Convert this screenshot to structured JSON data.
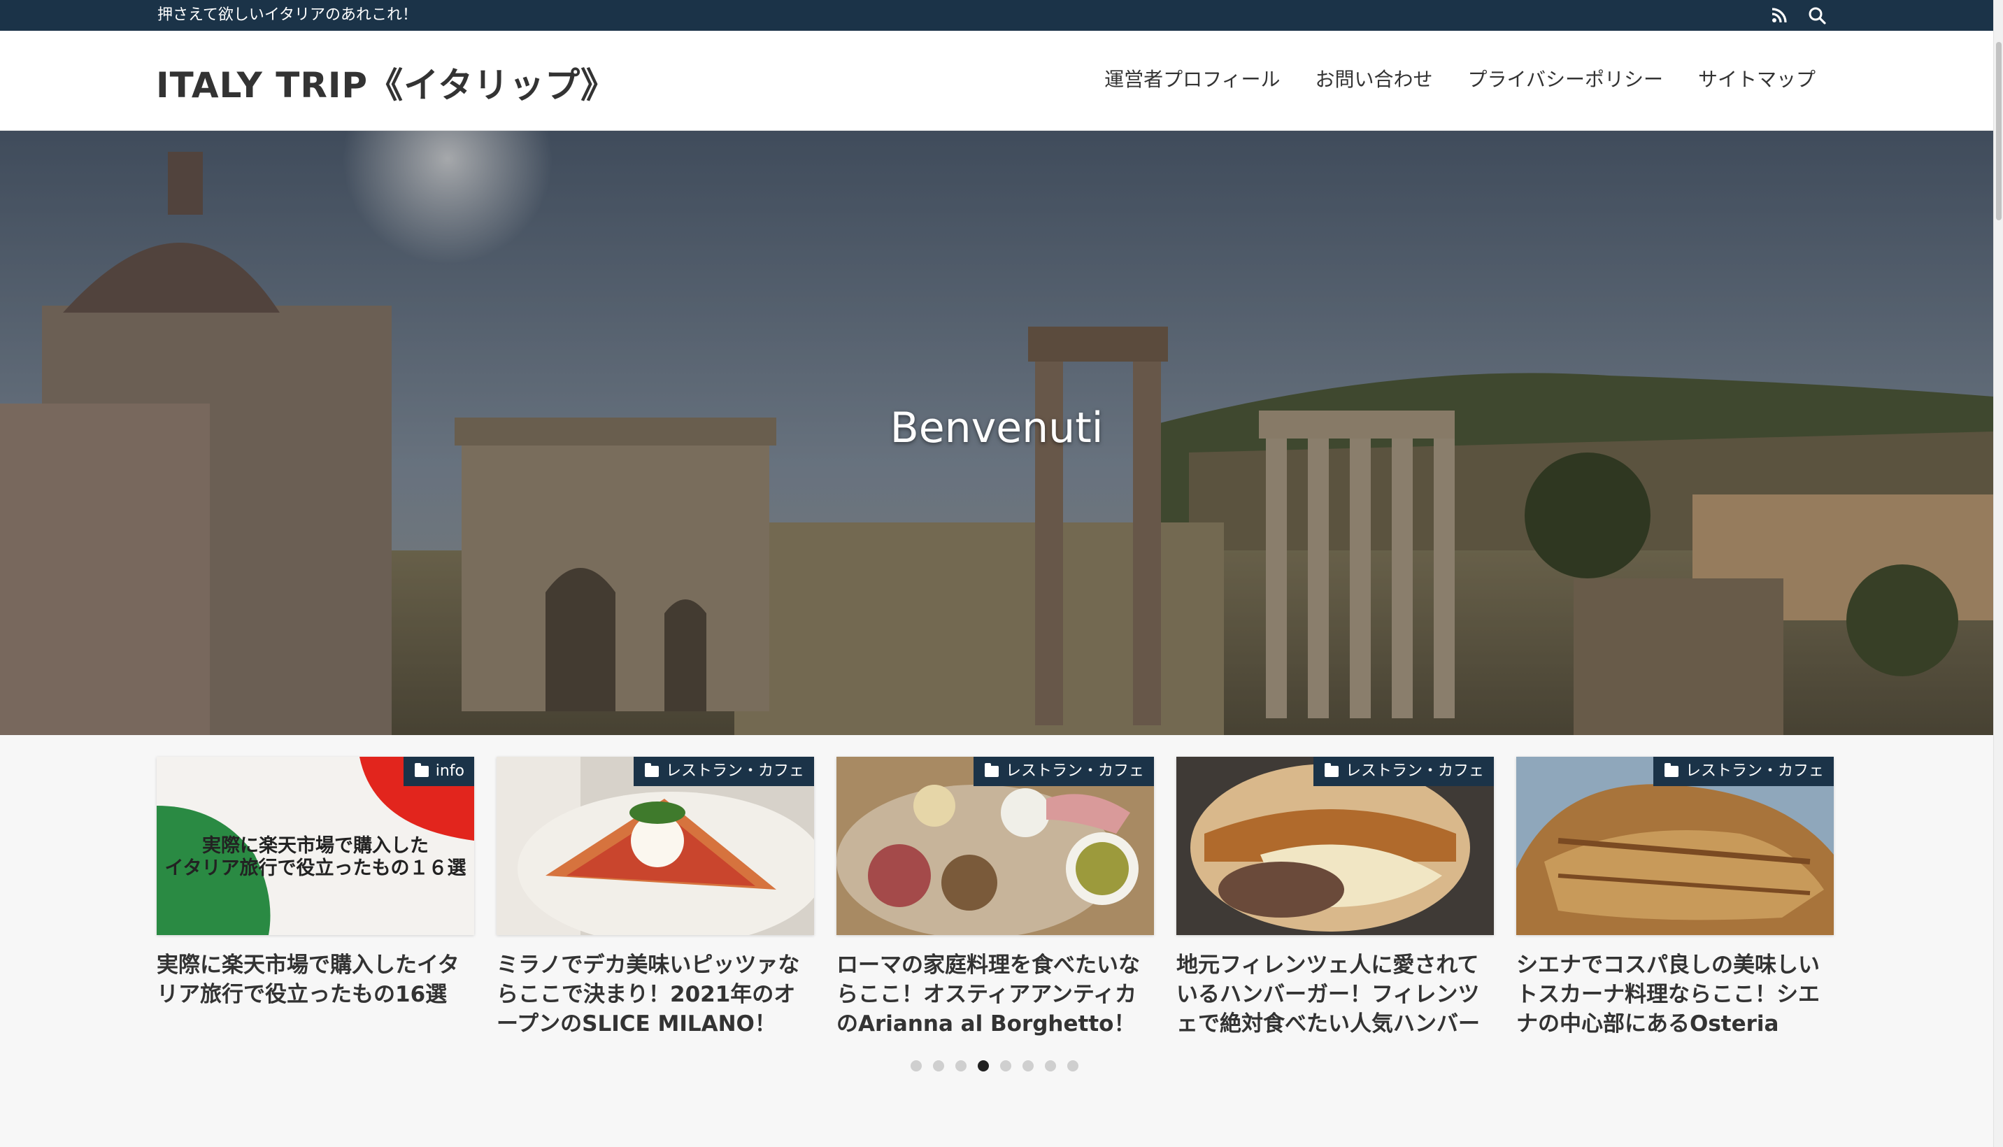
{
  "topbar": {
    "tagline": "押さえて欲しいイタリアのあれこれ！",
    "icons": [
      "rss-icon",
      "search-icon"
    ]
  },
  "header": {
    "site_title": "ITALY TRIP《イタリップ》",
    "nav": [
      {
        "label": "運営者プロフィール"
      },
      {
        "label": "お問い合わせ"
      },
      {
        "label": "プライバシーポリシー"
      },
      {
        "label": "サイトマップ"
      }
    ]
  },
  "hero": {
    "title": "Benvenuti"
  },
  "cards": [
    {
      "category": "info",
      "thumb_text_line1": "実際に楽天市場で購入した",
      "thumb_text_line2": "イタリア旅行で役立ったもの１６選",
      "title": "実際に楽天市場で購入したイタリア旅行で役立ったもの16選"
    },
    {
      "category": "レストラン・カフェ",
      "title": "ミラノでデカ美味いピッツァならここで決まり！2021年のオープンのSLICE MILANO！"
    },
    {
      "category": "レストラン・カフェ",
      "title": "ローマの家庭料理を食べたいならここ！オスティアアンティカのArianna al Borghetto！"
    },
    {
      "category": "レストラン・カフェ",
      "title": "地元フィレンツェ人に愛されているハンバーガー！フィレンツェで絶対食べたい人気ハンバーガーシ"
    },
    {
      "category": "レストラン・カフェ",
      "title": "シエナでコスパ良しの美味しいトスカーナ料理ならここ！シエナの中心部にあるOsteria"
    }
  ],
  "pager": {
    "count": 8,
    "active_index": 3
  },
  "colors": {
    "topbar_bg": "#1b3348",
    "badge_bg": "#1b3348",
    "page_bg": "#f7f7f7"
  }
}
